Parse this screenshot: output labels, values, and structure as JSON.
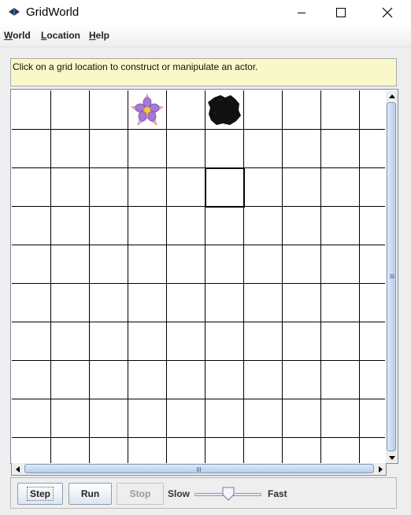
{
  "window": {
    "title": "GridWorld",
    "icon": "gridworld-bug-icon",
    "controls": [
      "minimize-icon",
      "maximize-icon",
      "close-icon"
    ]
  },
  "menubar": {
    "items": [
      {
        "mnemonic": "W",
        "rest": "orld"
      },
      {
        "mnemonic": "L",
        "rest": "ocation"
      },
      {
        "mnemonic": "H",
        "rest": "elp"
      }
    ]
  },
  "message": "Click on a grid location to construct or manipulate an actor.",
  "grid": {
    "visible_columns": 10,
    "visible_rows": 10,
    "actors": [
      {
        "type": "flower",
        "row": 0,
        "col": 3,
        "icon": "flower-icon",
        "color": "#9b6fc8"
      },
      {
        "type": "rock",
        "row": 0,
        "col": 5,
        "icon": "rock-icon",
        "color": "#111111"
      }
    ],
    "selected_cell": {
      "row": 2,
      "col": 5
    }
  },
  "controls": {
    "step_label": "Step",
    "run_label": "Run",
    "stop_label": "Stop",
    "slow_label": "Slow",
    "fast_label": "Fast",
    "speed_fraction": 0.5,
    "stop_enabled": false
  }
}
